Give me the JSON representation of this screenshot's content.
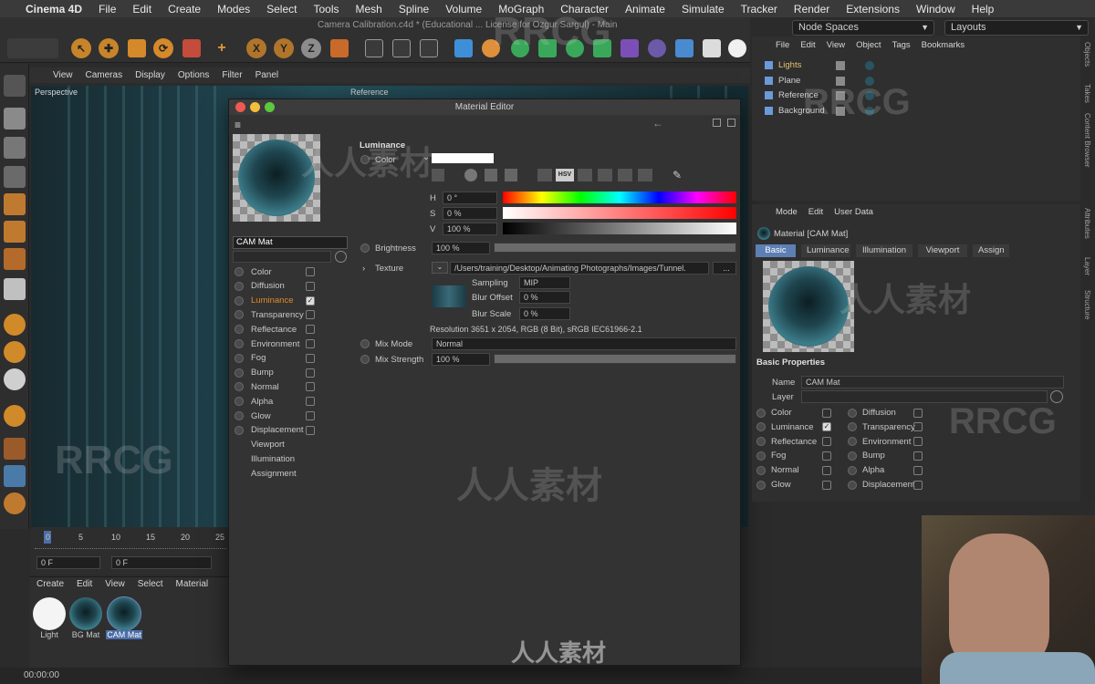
{
  "menubar": {
    "apple_glyph": "",
    "app_name": "Cinema 4D",
    "items": [
      "File",
      "Edit",
      "Create",
      "Modes",
      "Select",
      "Tools",
      "Mesh",
      "Spline",
      "Volume",
      "MoGraph",
      "Character",
      "Animate",
      "Simulate",
      "Tracker",
      "Render",
      "Extensions",
      "Window",
      "Help"
    ]
  },
  "toolbar": {
    "doc_title": "Camera Calibration.c4d * (Educational ... License for Ozgur Sargul) - Main",
    "axis_x": "X",
    "axis_y": "Y",
    "axis_z": "Z"
  },
  "node_spaces": {
    "label": "Node Spaces"
  },
  "layouts": {
    "label": "Layouts"
  },
  "viewport": {
    "menu": [
      "View",
      "Cameras",
      "Display",
      "Options",
      "Filter",
      "Panel"
    ],
    "name": "Perspective",
    "camera": "Reference"
  },
  "timeline": {
    "ticks": [
      "0",
      "5",
      "10",
      "15",
      "20",
      "25"
    ],
    "frame_start": "0 F",
    "frame_current": "0 F"
  },
  "material_manager": {
    "menu": [
      "Create",
      "Edit",
      "View",
      "Select",
      "Material"
    ],
    "materials": [
      {
        "label": "Light",
        "kind": "white"
      },
      {
        "label": "BG Mat",
        "kind": "sphere"
      },
      {
        "label": "CAM Mat",
        "kind": "sphere"
      }
    ]
  },
  "status_bar": {
    "time": "00:00:00"
  },
  "material_editor": {
    "title": "Material Editor",
    "name_value": "CAM Mat",
    "channels": [
      {
        "label": "Color",
        "checked": false,
        "active": false,
        "dot": true
      },
      {
        "label": "Diffusion",
        "checked": false,
        "active": false,
        "dot": true
      },
      {
        "label": "Luminance",
        "checked": true,
        "active": true,
        "dot": true
      },
      {
        "label": "Transparency",
        "checked": false,
        "active": false,
        "dot": true
      },
      {
        "label": "Reflectance",
        "checked": false,
        "active": false,
        "dot": true
      },
      {
        "label": "Environment",
        "checked": false,
        "active": false,
        "dot": true
      },
      {
        "label": "Fog",
        "checked": false,
        "active": false,
        "dot": true
      },
      {
        "label": "Bump",
        "checked": false,
        "active": false,
        "dot": true
      },
      {
        "label": "Normal",
        "checked": false,
        "active": false,
        "dot": true
      },
      {
        "label": "Alpha",
        "checked": false,
        "active": false,
        "dot": true
      },
      {
        "label": "Glow",
        "checked": false,
        "active": false,
        "dot": true
      },
      {
        "label": "Displacement",
        "checked": false,
        "active": false,
        "dot": true
      },
      {
        "label": "Viewport",
        "checked": false,
        "active": false,
        "dot": false
      },
      {
        "label": "Illumination",
        "checked": false,
        "active": false,
        "dot": false
      },
      {
        "label": "Assignment",
        "checked": false,
        "active": false,
        "dot": false
      }
    ],
    "section_title": "Luminance",
    "color_label": "Color",
    "hsv_mode_label": "HSV",
    "h": {
      "label": "H",
      "value": "0 °"
    },
    "s": {
      "label": "S",
      "value": "0 %"
    },
    "v": {
      "label": "V",
      "value": "100 %"
    },
    "brightness": {
      "label": "Brightness",
      "value": "100 %",
      "level": 1.0
    },
    "texture": {
      "label": "Texture",
      "path": "/Users/training/Desktop/Animating Photographs/Images/Tunnel.",
      "more": "...",
      "sampling_label": "Sampling",
      "sampling_value": "MIP",
      "blur_offset_label": "Blur Offset",
      "blur_offset_value": "0 %",
      "blur_scale_label": "Blur Scale",
      "blur_scale_value": "0 %",
      "resolution": "Resolution 3651 x 2054, RGB (8 Bit), sRGB IEC61966-2.1"
    },
    "mix_mode": {
      "label": "Mix Mode",
      "value": "Normal"
    },
    "mix_strength": {
      "label": "Mix Strength",
      "value": "100 %",
      "level": 1.0
    }
  },
  "object_manager": {
    "menu": [
      "File",
      "Edit",
      "View",
      "Object",
      "Tags",
      "Bookmarks"
    ],
    "objects": [
      {
        "label": "Lights",
        "selected": true
      },
      {
        "label": "Plane",
        "selected": false
      },
      {
        "label": "Reference",
        "selected": false
      },
      {
        "label": "Background",
        "selected": false
      }
    ]
  },
  "attribute_manager": {
    "menu": [
      "Mode",
      "Edit",
      "User Data"
    ],
    "header": "Material [CAM Mat]",
    "tabs": [
      "Basic",
      "Luminance",
      "Illumination",
      "Viewport",
      "Assign"
    ],
    "active_tab": "Basic",
    "section": "Basic Properties",
    "name_label": "Name",
    "name_value": "CAM Mat",
    "layer_label": "Layer",
    "left_channels": [
      {
        "label": "Color",
        "checked": false
      },
      {
        "label": "Luminance",
        "checked": true
      },
      {
        "label": "Reflectance",
        "checked": false
      },
      {
        "label": "Fog",
        "checked": false
      },
      {
        "label": "Normal",
        "checked": false
      },
      {
        "label": "Glow",
        "checked": false
      }
    ],
    "right_channels": [
      {
        "label": "Diffusion",
        "checked": false
      },
      {
        "label": "Transparency",
        "checked": false
      },
      {
        "label": "Environment",
        "checked": false
      },
      {
        "label": "Bump",
        "checked": false
      },
      {
        "label": "Alpha",
        "checked": false
      },
      {
        "label": "Displacement",
        "checked": false
      }
    ]
  },
  "side_tabs": [
    "Objects",
    "Takes",
    "Content Browser",
    "Attributes",
    "Layer",
    "Structure"
  ],
  "watermark": {
    "latin": "RRCG",
    "cjk": "人人素材"
  },
  "colors": {
    "accent_active": "#e08a2a",
    "tab_active": "#5d7fb4",
    "selected_object": "#e2c36b"
  }
}
